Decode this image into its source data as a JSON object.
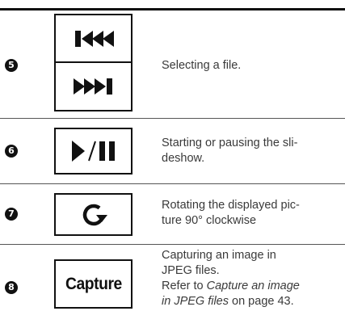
{
  "rows": [
    {
      "number": "5",
      "buttons": [
        "previous-file-icon",
        "next-file-icon"
      ],
      "description": "Selecting a file."
    },
    {
      "number": "6",
      "buttons": [
        "play-pause-icon"
      ],
      "description_lines": [
        "Starting or pausing the sli-",
        "deshow."
      ]
    },
    {
      "number": "7",
      "buttons": [
        "rotate-clockwise-icon"
      ],
      "description_lines": [
        "Rotating the displayed pic-",
        "ture 90° clockwise"
      ]
    },
    {
      "number": "8",
      "button_label": "Capture",
      "description_lines": [
        "Capturing an image in",
        "JPEG files."
      ],
      "ref_prefix": "Refer to ",
      "ref_title_line1": "Capture an image",
      "ref_title_line2": "in JPEG files",
      "ref_suffix": " on page 43."
    }
  ]
}
